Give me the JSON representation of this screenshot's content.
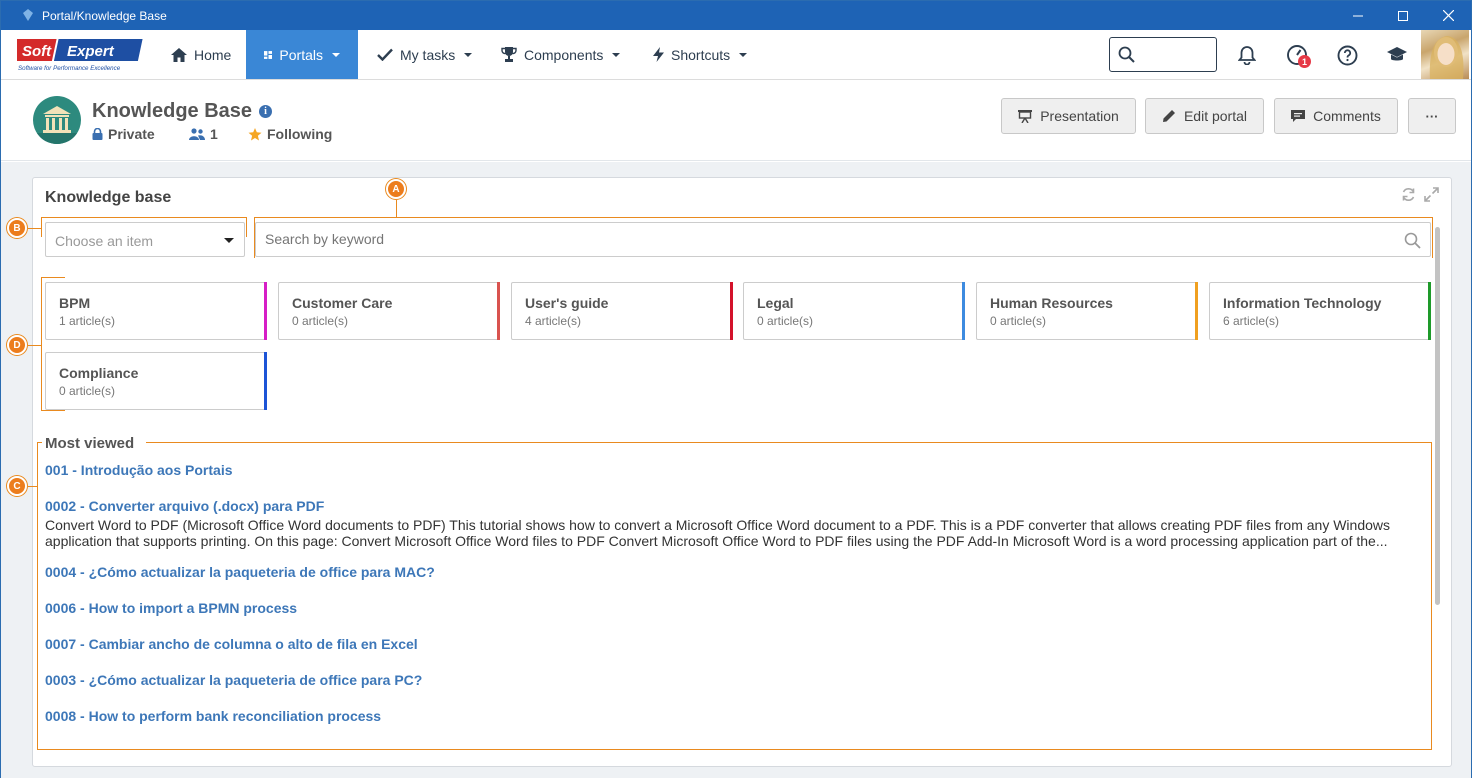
{
  "window": {
    "title": "Portal/Knowledge Base"
  },
  "brand": {
    "logo_main": "Soft Expert",
    "logo_tagline": "Software for Performance Excellence",
    "accent": "#3a87d6",
    "dark": "#1e63b5"
  },
  "nav": {
    "home": "Home",
    "portals": "Portals",
    "my_tasks": "My tasks",
    "components": "Components",
    "shortcuts": "Shortcuts",
    "search_placeholder": "",
    "notification_badge": "1"
  },
  "portal": {
    "title": "Knowledge Base",
    "privacy": "Private",
    "members": "1",
    "following": "Following",
    "buttons": {
      "presentation": "Presentation",
      "edit": "Edit portal",
      "comments": "Comments",
      "more": "···"
    }
  },
  "widget": {
    "title": "Knowledge base",
    "select_placeholder": "Choose an item",
    "keyword_placeholder": "Search by keyword",
    "categories": [
      {
        "name": "BPM",
        "count": "1 article(s)",
        "color": "#d61ec6"
      },
      {
        "name": "Customer Care",
        "count": "0 article(s)",
        "color": "#d9534f"
      },
      {
        "name": "User's guide",
        "count": "4 article(s)",
        "color": "#d3122a"
      },
      {
        "name": "Legal",
        "count": "0 article(s)",
        "color": "#3d8be0"
      },
      {
        "name": "Human Resources",
        "count": "0 article(s)",
        "color": "#f0a020"
      },
      {
        "name": "Information Technology",
        "count": "6 article(s)",
        "color": "#1e9a2a"
      },
      {
        "name": "Compliance",
        "count": "0 article(s)",
        "color": "#1c54d6"
      }
    ],
    "most_viewed_title": "Most viewed",
    "articles": [
      "001 - Introdução aos Portais",
      "0002 - Converter arquivo (.docx) para PDF",
      "0004 - ¿Cómo actualizar la paqueteria de office para MAC?",
      "0006 - How to import a BPMN process",
      "0007 - Cambiar ancho de columna o alto de fila en Excel",
      "0003 - ¿Cómo actualizar la paqueteria de office para PC?",
      "0008 - How to perform bank reconciliation process"
    ],
    "article_desc_line1": "Convert Word to PDF (Microsoft Office Word documents to PDF) This tutorial shows how to convert a Microsoft Office Word document to a PDF. This is a PDF converter that allows creating PDF files from any Windows",
    "article_desc_line2": "application that supports printing. On this page: Convert Microsoft Office Word files to PDF Convert Microsoft Office Word to PDF files using the PDF Add-In Microsoft Word is a word processing application part of the..."
  },
  "callouts": {
    "a": "A",
    "b": "B",
    "c": "C",
    "d": "D"
  }
}
